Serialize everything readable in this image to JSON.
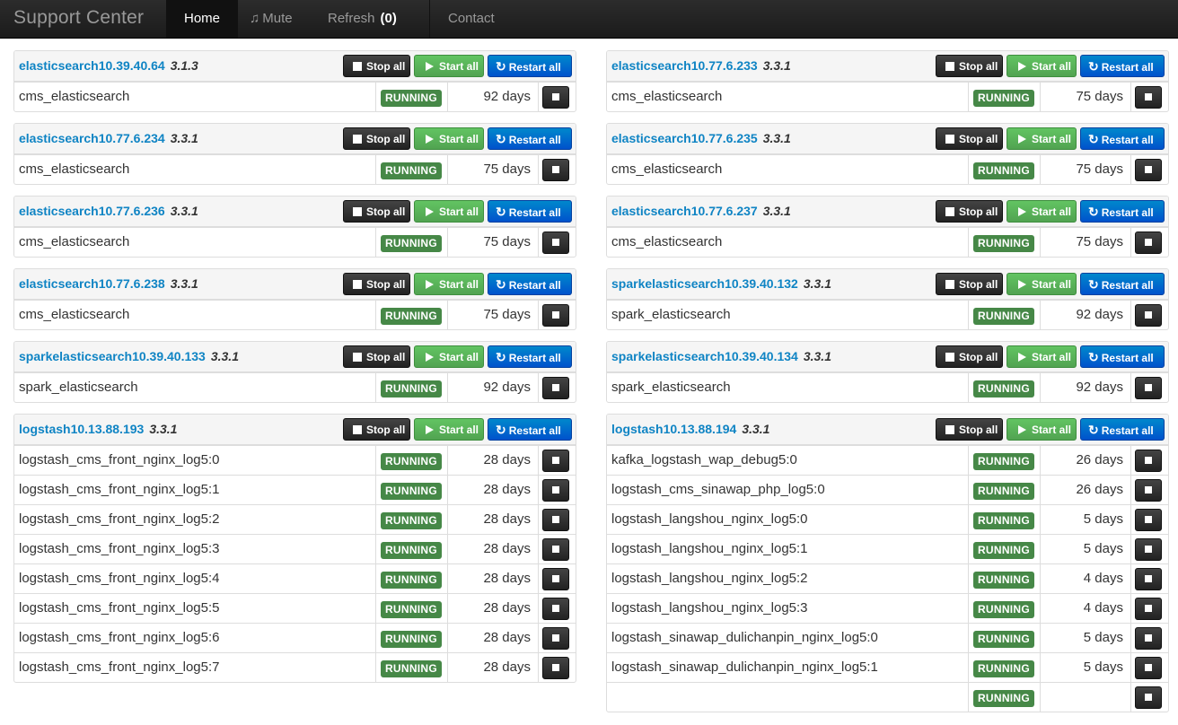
{
  "navbar": {
    "brand": "Support Center",
    "home": "Home",
    "mute": "Mute",
    "refresh": "Refresh",
    "refresh_count": "(0)",
    "contact": "Contact"
  },
  "labels": {
    "stop_all": "Stop all",
    "start_all": "Start all",
    "restart_all": "Restart all"
  },
  "colors": {
    "link": "#0f84c4",
    "running": "#468847",
    "stop": "#222222",
    "start": "#51a351",
    "restart": "#0052cc"
  },
  "columns": [
    [
      {
        "host": "elasticsearch10.39.40.64",
        "version": "3.1.3",
        "processes": [
          {
            "name": "cms_elasticsearch",
            "status": "RUNNING",
            "uptime": "92 days"
          }
        ]
      },
      {
        "host": "elasticsearch10.77.6.234",
        "version": "3.3.1",
        "processes": [
          {
            "name": "cms_elasticsearch",
            "status": "RUNNING",
            "uptime": "75 days"
          }
        ]
      },
      {
        "host": "elasticsearch10.77.6.236",
        "version": "3.3.1",
        "processes": [
          {
            "name": "cms_elasticsearch",
            "status": "RUNNING",
            "uptime": "75 days"
          }
        ]
      },
      {
        "host": "elasticsearch10.77.6.238",
        "version": "3.3.1",
        "processes": [
          {
            "name": "cms_elasticsearch",
            "status": "RUNNING",
            "uptime": "75 days"
          }
        ]
      },
      {
        "host": "sparkelasticsearch10.39.40.133",
        "version": "3.3.1",
        "processes": [
          {
            "name": "spark_elasticsearch",
            "status": "RUNNING",
            "uptime": "92 days"
          }
        ]
      },
      {
        "host": "logstash10.13.88.193",
        "version": "3.3.1",
        "processes": [
          {
            "name": "logstash_cms_front_nginx_log5:0",
            "status": "RUNNING",
            "uptime": "28 days"
          },
          {
            "name": "logstash_cms_front_nginx_log5:1",
            "status": "RUNNING",
            "uptime": "28 days"
          },
          {
            "name": "logstash_cms_front_nginx_log5:2",
            "status": "RUNNING",
            "uptime": "28 days"
          },
          {
            "name": "logstash_cms_front_nginx_log5:3",
            "status": "RUNNING",
            "uptime": "28 days"
          },
          {
            "name": "logstash_cms_front_nginx_log5:4",
            "status": "RUNNING",
            "uptime": "28 days"
          },
          {
            "name": "logstash_cms_front_nginx_log5:5",
            "status": "RUNNING",
            "uptime": "28 days"
          },
          {
            "name": "logstash_cms_front_nginx_log5:6",
            "status": "RUNNING",
            "uptime": "28 days"
          },
          {
            "name": "logstash_cms_front_nginx_log5:7",
            "status": "RUNNING",
            "uptime": "28 days"
          }
        ]
      }
    ],
    [
      {
        "host": "elasticsearch10.77.6.233",
        "version": "3.3.1",
        "processes": [
          {
            "name": "cms_elasticsearch",
            "status": "RUNNING",
            "uptime": "75 days"
          }
        ]
      },
      {
        "host": "elasticsearch10.77.6.235",
        "version": "3.3.1",
        "processes": [
          {
            "name": "cms_elasticsearch",
            "status": "RUNNING",
            "uptime": "75 days"
          }
        ]
      },
      {
        "host": "elasticsearch10.77.6.237",
        "version": "3.3.1",
        "processes": [
          {
            "name": "cms_elasticsearch",
            "status": "RUNNING",
            "uptime": "75 days"
          }
        ]
      },
      {
        "host": "sparkelasticsearch10.39.40.132",
        "version": "3.3.1",
        "processes": [
          {
            "name": "spark_elasticsearch",
            "status": "RUNNING",
            "uptime": "92 days"
          }
        ]
      },
      {
        "host": "sparkelasticsearch10.39.40.134",
        "version": "3.3.1",
        "processes": [
          {
            "name": "spark_elasticsearch",
            "status": "RUNNING",
            "uptime": "92 days"
          }
        ]
      },
      {
        "host": "logstash10.13.88.194",
        "version": "3.3.1",
        "processes": [
          {
            "name": "kafka_logstash_wap_debug5:0",
            "status": "RUNNING",
            "uptime": "26 days"
          },
          {
            "name": "logstash_cms_sinawap_php_log5:0",
            "status": "RUNNING",
            "uptime": "26 days"
          },
          {
            "name": "logstash_langshou_nginx_log5:0",
            "status": "RUNNING",
            "uptime": "5 days"
          },
          {
            "name": "logstash_langshou_nginx_log5:1",
            "status": "RUNNING",
            "uptime": "5 days"
          },
          {
            "name": "logstash_langshou_nginx_log5:2",
            "status": "RUNNING",
            "uptime": "4 days"
          },
          {
            "name": "logstash_langshou_nginx_log5:3",
            "status": "RUNNING",
            "uptime": "4 days"
          },
          {
            "name": "logstash_sinawap_dulichanpin_nginx_log5:0",
            "status": "RUNNING",
            "uptime": "5 days"
          },
          {
            "name": "logstash_sinawap_dulichanpin_nginx_log5:1",
            "status": "RUNNING",
            "uptime": "5 days"
          },
          {
            "name": "",
            "status": "RUNNING",
            "uptime": ""
          }
        ]
      }
    ]
  ]
}
